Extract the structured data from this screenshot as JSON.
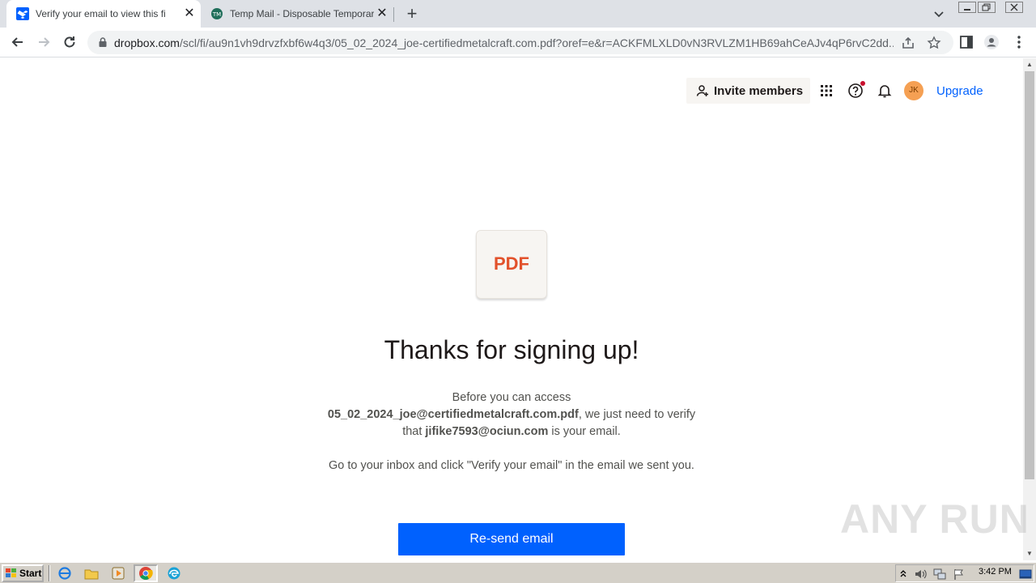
{
  "browser": {
    "tabs": [
      {
        "title": "Verify your email to view this file",
        "favicon": "dropbox-icon",
        "active": true
      },
      {
        "title": "Temp Mail - Disposable Temporary Email",
        "favicon": "tempmail-icon",
        "active": false
      }
    ],
    "url_host": "dropbox.com",
    "url_path": "/scl/fi/au9n1vh9drvzfxbf6w4q3/05_02_2024_joe-certifiedmetalcraft.com.pdf?oref=e&r=ACKFMLXLD0vN3RVLZM1HB69ahCeAJv4qP6rvC2dd..."
  },
  "header": {
    "invite_label": "Invite members",
    "avatar_initials": "JK",
    "upgrade_label": "Upgrade"
  },
  "main": {
    "file_badge": "PDF",
    "heading": "Thanks for signing up!",
    "para1_prefix": "Before you can access",
    "filename": "05_02_2024_joe@certifiedmetalcraft.com.pdf",
    "para1_mid": ", we just need to verify that ",
    "email": "jifike7593@ociun.com",
    "para1_suffix": " is your email.",
    "para2": "Go to your inbox and click \"Verify your email\" in the email we sent you.",
    "resend_label": "Re-send email"
  },
  "watermark": "ANY RUN",
  "taskbar": {
    "start_label": "Start",
    "clock": "3:42 PM"
  }
}
